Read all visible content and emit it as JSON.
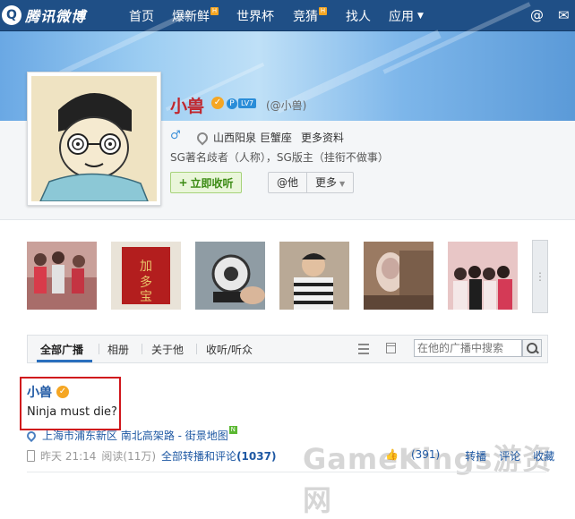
{
  "nav": {
    "logo_text": "腾讯微博",
    "items": [
      {
        "label": "首页",
        "hot": false
      },
      {
        "label": "爆新鲜",
        "hot": true
      },
      {
        "label": "世界杯",
        "hot": false
      },
      {
        "label": "竞猜",
        "hot": true
      },
      {
        "label": "找人",
        "hot": false
      },
      {
        "label": "应用",
        "hot": false,
        "dropdown": true
      }
    ],
    "hot_badge": "H",
    "at_icon": "@",
    "mail_icon": "envelope-icon"
  },
  "profile": {
    "name": "小兽",
    "level": "LV7",
    "handle": "(@小兽)",
    "gender_symbol": "♂",
    "location": "山西阳泉 巨蟹座",
    "more_info": "更多资料",
    "bio": "SG著名歧者（人称），SG版主（挂衔不做事）",
    "follow_label": "立即收听",
    "at_label": "@他",
    "more_label": "更多"
  },
  "photos_more": "⋮",
  "tabs": {
    "items": [
      "全部广播",
      "相册",
      "关于他",
      "收听/听众"
    ],
    "search_placeholder": "在他的广播中搜索"
  },
  "post": {
    "author": "小兽",
    "text": "Ninja must die?",
    "location_text": "上海市浦东新区 南北高架路 - 街景地图",
    "location_badge": "N",
    "time": "昨天 21:14",
    "reads": "阅读(11万)",
    "all_label": "全部转播和评论",
    "all_count": "(1037)",
    "likes": "(391)",
    "repost": "转播",
    "comment": "评论",
    "favorite": "收藏"
  },
  "watermark": "GameKings游资网",
  "colors": {
    "nav_bg": "#1f4f86",
    "name_red": "#c0262d",
    "link_blue": "#1e58a3",
    "follow_green": "#3a8a12",
    "highlight_red": "#d0161c"
  }
}
